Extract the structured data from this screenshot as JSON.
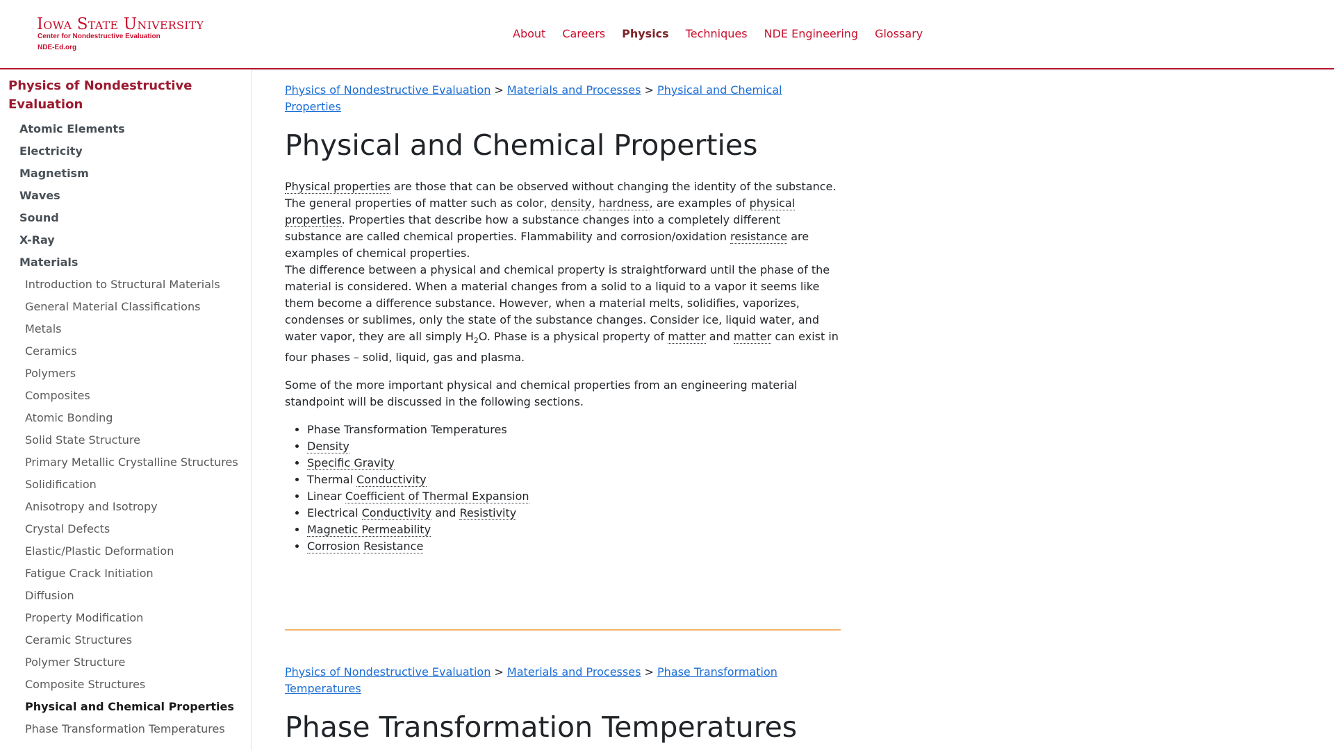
{
  "header": {
    "logo_line1": "Iowa State University",
    "logo_line2": "Center for Nondestructive Evaluation",
    "logo_line3": "NDE-Ed.org",
    "nav": [
      {
        "label": "About",
        "active": false
      },
      {
        "label": "Careers",
        "active": false
      },
      {
        "label": "Physics",
        "active": true
      },
      {
        "label": "Techniques",
        "active": false
      },
      {
        "label": "NDE Engineering",
        "active": false
      },
      {
        "label": "Glossary",
        "active": false
      }
    ]
  },
  "sidebar": {
    "title": "Physics of Nondestructive Evaluation",
    "items": [
      {
        "label": "Atomic Elements",
        "level": 1
      },
      {
        "label": "Electricity",
        "level": 1
      },
      {
        "label": "Magnetism",
        "level": 1
      },
      {
        "label": "Waves",
        "level": 1
      },
      {
        "label": "Sound",
        "level": 1
      },
      {
        "label": "X-Ray",
        "level": 1
      },
      {
        "label": "Materials",
        "level": 1
      },
      {
        "label": "Introduction to Structural Materials",
        "level": 2
      },
      {
        "label": "General Material Classifications",
        "level": 2
      },
      {
        "label": "Metals",
        "level": 2
      },
      {
        "label": "Ceramics",
        "level": 2
      },
      {
        "label": "Polymers",
        "level": 2
      },
      {
        "label": "Composites",
        "level": 2
      },
      {
        "label": "Atomic Bonding",
        "level": 2
      },
      {
        "label": "Solid State Structure",
        "level": 2
      },
      {
        "label": "Primary Metallic Crystalline Structures",
        "level": 2
      },
      {
        "label": "Solidification",
        "level": 2
      },
      {
        "label": "Anisotropy and Isotropy",
        "level": 2
      },
      {
        "label": "Crystal Defects",
        "level": 2
      },
      {
        "label": "Elastic/Plastic Deformation",
        "level": 2
      },
      {
        "label": "Fatigue Crack Initiation",
        "level": 2
      },
      {
        "label": "Diffusion",
        "level": 2
      },
      {
        "label": "Property Modification",
        "level": 2
      },
      {
        "label": "Ceramic Structures",
        "level": 2
      },
      {
        "label": "Polymer Structure",
        "level": 2
      },
      {
        "label": "Composite Structures",
        "level": 2
      },
      {
        "label": "Physical and Chemical Properties",
        "level": 2,
        "active": true
      },
      {
        "label": "Phase Transformation Temperatures",
        "level": 2
      }
    ]
  },
  "section1": {
    "breadcrumb": {
      "crumb1": "Physics of Nondestructive Evaluation",
      "crumb2": "Materials and Processes",
      "crumb3": "Physical and Chemical Properties",
      "sep": ">"
    },
    "title": "Physical and Chemical Properties",
    "p1": {
      "a": "Physical properties",
      "b": " are those that can be observed without changing the identity of the substance. The general properties of matter such as color, ",
      "c": "density",
      "d": ", ",
      "e": "hardness",
      "f": ", are examples of ",
      "g": "physical properties",
      "h": ". Properties that describe how a substance changes into a completely different substance are called chemical properties. Flammability and corrosion/oxidation ",
      "i": "resistance",
      "j": " are examples of chemical properties."
    },
    "p2": {
      "a": "The difference between a physical and chemical property is straightforward until the phase of the material is considered. When a material changes from a solid to a liquid to a vapor it seems like them become a difference substance. However, when a material melts, solidifies, vaporizes, condenses or sublimes, only the state of the substance changes. Consider ice, liquid water, and water vapor, they are all simply H",
      "sub": "2",
      "b": "O. Phase is a physical property of ",
      "c": "matter",
      "d": " and ",
      "e": "matter",
      "f": " can exist in four phases – solid, liquid, gas and plasma."
    },
    "p3": "Some of the more important physical and chemical properties from an engineering material standpoint will be discussed in the following sections.",
    "list": {
      "i1": "Phase Transformation Temperatures",
      "i2": "Density",
      "i3": "Specific Gravity",
      "i4a": "Thermal ",
      "i4b": "Conductivity",
      "i5a": "Linear ",
      "i5b": "Coefficient of Thermal Expansion",
      "i6a": "Electrical ",
      "i6b": "Conductivity",
      "i6c": " and ",
      "i6d": "Resistivity",
      "i7": "Magnetic Permeability",
      "i8a": "Corrosion",
      "i8b": " ",
      "i8c": "Resistance"
    }
  },
  "section2": {
    "breadcrumb": {
      "crumb1": "Physics of Nondestructive Evaluation",
      "crumb2": "Materials and Processes",
      "crumb3": "Phase Transformation Temperatures",
      "sep": ">"
    },
    "title": "Phase Transformation Temperatures"
  },
  "colors": {
    "brand": "#c8102e",
    "sidebar_title": "#9b1b30",
    "link": "#1a6dd5",
    "divider": "#f6b26b"
  }
}
